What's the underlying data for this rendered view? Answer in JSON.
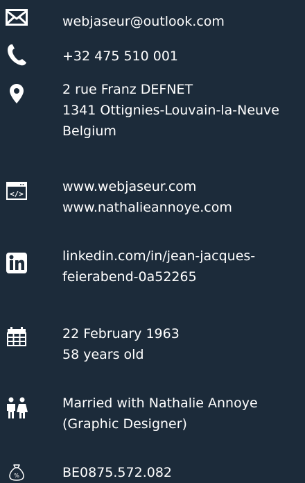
{
  "contact": {
    "email": "webjaseur@outlook.com",
    "phone": "+32 475 510 001",
    "address": {
      "line1": "2 rue Franz DEFNET",
      "line2": "1341 Ottignies-Louvain-la-Neuve",
      "line3": "Belgium"
    },
    "websites": {
      "site1": "www.webjaseur.com",
      "site2": "www.nathalieannoye.com"
    },
    "linkedin": {
      "line1": "linkedin.com/in/jean-jacques-",
      "line2": "feierabend-0a52265"
    },
    "birth": {
      "date": "22 February 1963",
      "age": "58 years old"
    },
    "family": {
      "line1": "Married with Nathalie Annoye",
      "line2": "(Graphic Designer)"
    },
    "vat": "BE0875.572.082"
  },
  "icons": {
    "email": "envelope-icon",
    "phone": "phone-icon",
    "address": "map-pin-icon",
    "web": "code-window-icon",
    "linkedin": "linkedin-icon",
    "birth": "calendar-icon",
    "family": "couple-icon",
    "vat": "money-bag-icon"
  },
  "colors": {
    "background": "#1c2b3a",
    "text": "#ffffff"
  }
}
